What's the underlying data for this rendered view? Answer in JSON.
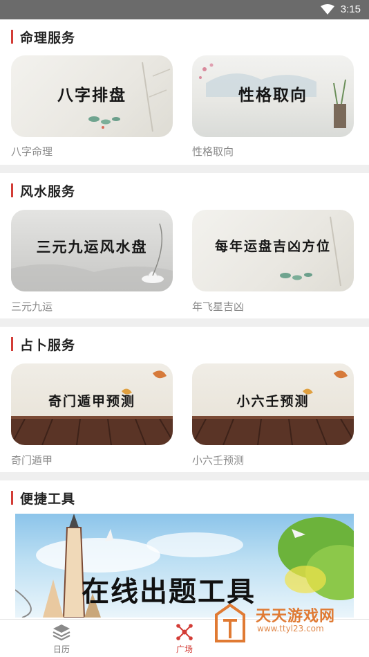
{
  "status_bar": {
    "time": "3:15"
  },
  "sections": [
    {
      "title": "命理服务",
      "cards": [
        {
          "image_text": "八字排盘",
          "label": "八字命理"
        },
        {
          "image_text": "性格取向",
          "label": "性格取向"
        }
      ]
    },
    {
      "title": "风水服务",
      "cards": [
        {
          "image_text": "三元九运风水盘",
          "label": "三元九运"
        },
        {
          "image_text": "每年运盘吉凶方位",
          "label": "年飞星吉凶"
        }
      ]
    },
    {
      "title": "占卜服务",
      "cards": [
        {
          "image_text": "奇门遁甲预测",
          "label": "奇门遁甲"
        },
        {
          "image_text": "小六壬预测",
          "label": "小六壬预测"
        }
      ]
    },
    {
      "title": "便捷工具",
      "banner_text": "在线出题工具"
    }
  ],
  "bottom_nav": [
    {
      "label": "日历",
      "icon": "layers-icon",
      "active": false
    },
    {
      "label": "广场",
      "icon": "network-icon",
      "active": true
    }
  ],
  "watermark": {
    "text": "天天游戏网",
    "url": "www.ttyl23.com"
  },
  "colors": {
    "accent": "#d33c36",
    "label_gray": "#8a8a8a"
  }
}
